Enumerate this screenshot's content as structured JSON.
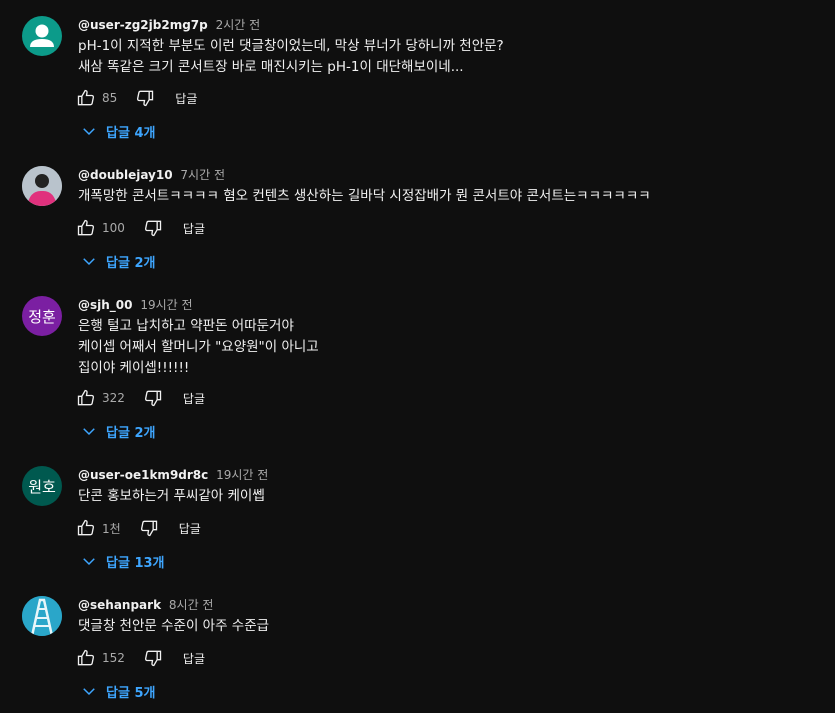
{
  "comments": [
    {
      "author": "@user-zg2jb2mg7p",
      "time": "2시간 전",
      "lines": [
        "pH-1이 지적한 부분도 이런 댓글창이었는데, 막상 뷰너가 당하니까 천안문?",
        "새삼 똑같은 크기 콘서트장 바로 매진시키는 pH-1이 대단해보이네..."
      ],
      "likes": "85",
      "reply_label": "답글",
      "replies": "답글 4개",
      "avatar_text": "",
      "avatar_color": "#0c9b8a"
    },
    {
      "author": "@doublejay10",
      "time": "7시간 전",
      "lines": [
        "개폭망한 콘서트ㅋㅋㅋㅋ 혐오 컨텐츠 생산하는 길바닥 시정잡배가 뭔 콘서트야 콘서트는ㅋㅋㅋㅋㅋㅋ"
      ],
      "likes": "100",
      "reply_label": "답글",
      "replies": "답글 2개",
      "avatar_text": "",
      "avatar_color": "#9aa6b0"
    },
    {
      "author": "@sjh_00",
      "time": "19시간 전",
      "lines": [
        "은행 털고 납치하고 약판돈 어따둔거야",
        "케이셉 어째서 할머니가 \"요양원\"이 아니고",
        "집이야 케이셉!!!!!!"
      ],
      "likes": "322",
      "reply_label": "답글",
      "replies": "답글 2개",
      "avatar_text": "정훈",
      "avatar_color": "#7b1fa2"
    },
    {
      "author": "@user-oe1km9dr8c",
      "time": "19시간 전",
      "lines": [
        "단콘 홍보하는거 푸씨같아 케이쎕"
      ],
      "likes": "1천",
      "reply_label": "답글",
      "replies": "답글 13개",
      "avatar_text": "원호",
      "avatar_color": "#00594f"
    },
    {
      "author": "@sehanpark",
      "time": "8시간 전",
      "lines": [
        "댓글창 천안문 수준이 아주 수준급"
      ],
      "likes": "152",
      "reply_label": "답글",
      "replies": "답글 5개",
      "avatar_text": "",
      "avatar_color": "#1b8fb0"
    }
  ]
}
